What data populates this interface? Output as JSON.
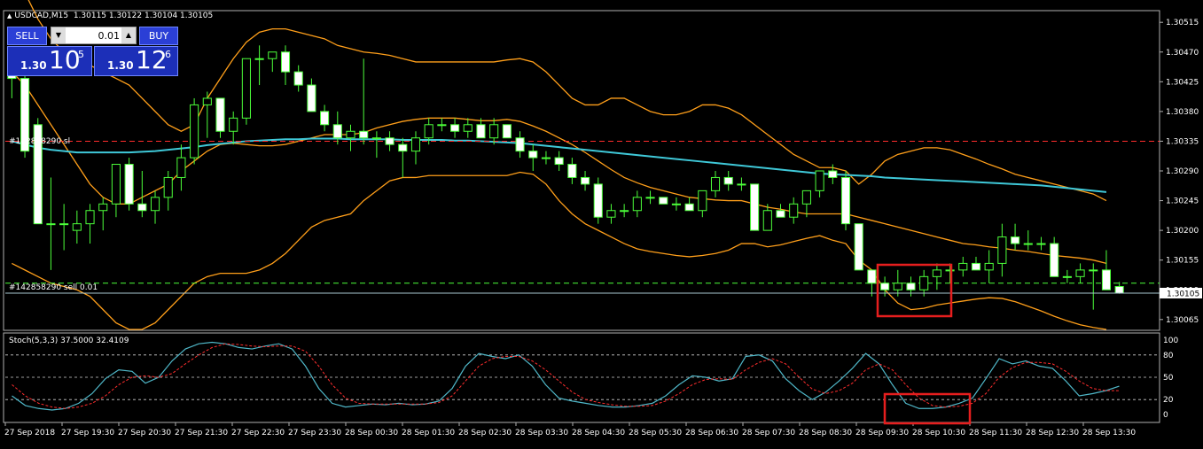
{
  "header": {
    "symbol_tf": "USDCAD,M15",
    "ohlc": "1.30115 1.30122 1.30104 1.30105"
  },
  "trade_panel": {
    "sell_label": "SELL",
    "buy_label": "BUY",
    "lot_value": "0.01",
    "sell_price_prefix": "1.30",
    "sell_price_big": "10",
    "sell_price_sup": "5",
    "buy_price_prefix": "1.30",
    "buy_price_big": "12",
    "buy_price_sup": "6"
  },
  "order_lines": {
    "sl_label": "#142858290 sl",
    "sl_price": 1.30335,
    "entry_label": "#142858290 sell 0.01",
    "entry_price": 1.3012
  },
  "current_price_label": "1.30105",
  "stoch_header": "Stoch(5,3,3) 37.5000 32.4109",
  "colors": {
    "bull": "#ffffff",
    "bear": "#ffffff",
    "wick": "#4cff3a",
    "ma_slow": "#3fc8d8",
    "bollinger": "#ff9f1a",
    "sl_line": "#ff2d2d",
    "entry_line": "#4cff3a",
    "stoch_main": "#4fb7c8",
    "stoch_signal": "#ff2d2d",
    "highlight": "#e61e1e"
  },
  "chart_data": {
    "type": "candlestick",
    "symbol": "USDCAD",
    "timeframe": "M15",
    "ylim": [
      1.3005,
      1.3053
    ],
    "price_ticks": [
      "1.30515",
      "1.30470",
      "1.30425",
      "1.30380",
      "1.30335",
      "1.30290",
      "1.30245",
      "1.30200",
      "1.30155",
      "1.30110",
      "1.30065"
    ],
    "time_labels": [
      "27 Sep 2018",
      "27 Sep 19:30",
      "27 Sep 20:30",
      "27 Sep 21:30",
      "27 Sep 22:30",
      "27 Sep 23:30",
      "28 Sep 00:30",
      "28 Sep 01:30",
      "28 Sep 02:30",
      "28 Sep 03:30",
      "28 Sep 04:30",
      "28 Sep 05:30",
      "28 Sep 06:30",
      "28 Sep 07:30",
      "28 Sep 08:30",
      "28 Sep 09:30",
      "28 Sep 10:30",
      "28 Sep 11:30",
      "28 Sep 12:30",
      "28 Sep 13:30"
    ],
    "candles": [
      [
        1.3044,
        1.3045,
        1.304,
        1.3043
      ],
      [
        1.3043,
        1.3044,
        1.3031,
        1.3032
      ],
      [
        1.3036,
        1.3037,
        1.3021,
        1.3021
      ],
      [
        1.3021,
        1.3028,
        1.3014,
        1.3021
      ],
      [
        1.3021,
        1.3024,
        1.3017,
        1.3021
      ],
      [
        1.302,
        1.3023,
        1.3018,
        1.3021
      ],
      [
        1.3021,
        1.3024,
        1.3018,
        1.3023
      ],
      [
        1.3023,
        1.3025,
        1.302,
        1.3024
      ],
      [
        1.3024,
        1.303,
        1.3022,
        1.303
      ],
      [
        1.303,
        1.3031,
        1.3023,
        1.3024
      ],
      [
        1.3024,
        1.3029,
        1.3022,
        1.3023
      ],
      [
        1.3023,
        1.3026,
        1.3021,
        1.3025
      ],
      [
        1.3025,
        1.3029,
        1.3023,
        1.3028
      ],
      [
        1.3028,
        1.3033,
        1.3026,
        1.3031
      ],
      [
        1.3031,
        1.304,
        1.303,
        1.3039
      ],
      [
        1.3039,
        1.3041,
        1.3034,
        1.304
      ],
      [
        1.304,
        1.304,
        1.3034,
        1.3035
      ],
      [
        1.3035,
        1.3038,
        1.3033,
        1.3037
      ],
      [
        1.3037,
        1.3046,
        1.3036,
        1.3046
      ],
      [
        1.3046,
        1.3048,
        1.3042,
        1.3046
      ],
      [
        1.3046,
        1.3047,
        1.3044,
        1.3047
      ],
      [
        1.3047,
        1.3048,
        1.3042,
        1.3044
      ],
      [
        1.3044,
        1.3045,
        1.3041,
        1.3042
      ],
      [
        1.3042,
        1.3043,
        1.3038,
        1.3038
      ],
      [
        1.3038,
        1.3039,
        1.3035,
        1.3036
      ],
      [
        1.3036,
        1.3038,
        1.3033,
        1.3034
      ],
      [
        1.3034,
        1.3036,
        1.3032,
        1.3035
      ],
      [
        1.3035,
        1.3046,
        1.3033,
        1.3034
      ],
      [
        1.3034,
        1.3035,
        1.3031,
        1.3034
      ],
      [
        1.3034,
        1.3035,
        1.3032,
        1.3033
      ],
      [
        1.3033,
        1.3034,
        1.3028,
        1.3032
      ],
      [
        1.3032,
        1.3035,
        1.303,
        1.3034
      ],
      [
        1.3034,
        1.3037,
        1.3033,
        1.3036
      ],
      [
        1.3036,
        1.3037,
        1.3035,
        1.3036
      ],
      [
        1.3036,
        1.3037,
        1.3034,
        1.3035
      ],
      [
        1.3035,
        1.3037,
        1.3034,
        1.3036
      ],
      [
        1.3036,
        1.3037,
        1.3034,
        1.3034
      ],
      [
        1.3034,
        1.3037,
        1.3033,
        1.3036
      ],
      [
        1.3036,
        1.3036,
        1.3034,
        1.3034
      ],
      [
        1.3034,
        1.3035,
        1.3031,
        1.3032
      ],
      [
        1.3032,
        1.3033,
        1.3029,
        1.3031
      ],
      [
        1.3031,
        1.3032,
        1.303,
        1.3031
      ],
      [
        1.3031,
        1.3032,
        1.3029,
        1.303
      ],
      [
        1.303,
        1.3031,
        1.3027,
        1.3028
      ],
      [
        1.3028,
        1.3029,
        1.3026,
        1.3027
      ],
      [
        1.3027,
        1.3028,
        1.3021,
        1.3022
      ],
      [
        1.3022,
        1.3024,
        1.3021,
        1.3023
      ],
      [
        1.3023,
        1.3024,
        1.3022,
        1.3023
      ],
      [
        1.3023,
        1.3026,
        1.3022,
        1.3025
      ],
      [
        1.3025,
        1.3026,
        1.3024,
        1.3025
      ],
      [
        1.3025,
        1.3025,
        1.3024,
        1.3024
      ],
      [
        1.3024,
        1.3025,
        1.3023,
        1.3024
      ],
      [
        1.3024,
        1.3025,
        1.3023,
        1.3023
      ],
      [
        1.3023,
        1.3026,
        1.3022,
        1.3026
      ],
      [
        1.3026,
        1.3029,
        1.3025,
        1.3028
      ],
      [
        1.3028,
        1.3029,
        1.3026,
        1.3027
      ],
      [
        1.3027,
        1.3028,
        1.3026,
        1.3027
      ],
      [
        1.3027,
        1.3027,
        1.302,
        1.302
      ],
      [
        1.302,
        1.3024,
        1.302,
        1.3023
      ],
      [
        1.3023,
        1.3024,
        1.3022,
        1.3022
      ],
      [
        1.3022,
        1.3025,
        1.3021,
        1.3024
      ],
      [
        1.3024,
        1.3026,
        1.3022,
        1.3026
      ],
      [
        1.3026,
        1.3029,
        1.3025,
        1.3029
      ],
      [
        1.3029,
        1.303,
        1.3027,
        1.3028
      ],
      [
        1.3028,
        1.3029,
        1.302,
        1.3021
      ],
      [
        1.3021,
        1.3021,
        1.3014,
        1.3014
      ],
      [
        1.3014,
        1.3014,
        1.301,
        1.3012
      ],
      [
        1.3012,
        1.3013,
        1.301,
        1.3011
      ],
      [
        1.3011,
        1.3014,
        1.301,
        1.3012
      ],
      [
        1.3012,
        1.3013,
        1.301,
        1.3011
      ],
      [
        1.3011,
        1.3014,
        1.301,
        1.3013
      ],
      [
        1.3013,
        1.3015,
        1.3011,
        1.3014
      ],
      [
        1.3014,
        1.3015,
        1.3012,
        1.3014
      ],
      [
        1.3014,
        1.3016,
        1.3013,
        1.3015
      ],
      [
        1.3015,
        1.3016,
        1.3014,
        1.3014
      ],
      [
        1.3014,
        1.3017,
        1.3012,
        1.3015
      ],
      [
        1.3015,
        1.3021,
        1.3013,
        1.3019
      ],
      [
        1.3019,
        1.3021,
        1.3017,
        1.3018
      ],
      [
        1.3018,
        1.302,
        1.3017,
        1.3018
      ],
      [
        1.3018,
        1.3019,
        1.3017,
        1.3018
      ],
      [
        1.3018,
        1.3019,
        1.3014,
        1.3013
      ],
      [
        1.3013,
        1.3014,
        1.3012,
        1.3013
      ],
      [
        1.3013,
        1.3015,
        1.3012,
        1.3014
      ],
      [
        1.3014,
        1.3015,
        1.3008,
        1.3014
      ],
      [
        1.3014,
        1.3017,
        1.3011,
        1.3011
      ],
      [
        1.30115,
        1.30122,
        1.30104,
        1.30105
      ]
    ],
    "ma": [
      1.30335,
      1.3033,
      1.30325,
      1.30322,
      1.3032,
      1.30318,
      1.30318,
      1.30318,
      1.30318,
      1.30318,
      1.30319,
      1.3032,
      1.30322,
      1.30324,
      1.30326,
      1.30329,
      1.30331,
      1.30333,
      1.30335,
      1.30336,
      1.30337,
      1.30338,
      1.30338,
      1.30339,
      1.30339,
      1.30339,
      1.30338,
      1.30338,
      1.30338,
      1.30338,
      1.30337,
      1.30337,
      1.30337,
      1.30337,
      1.30336,
      1.30336,
      1.30335,
      1.30334,
      1.30333,
      1.30332,
      1.3033,
      1.30328,
      1.30326,
      1.30324,
      1.30322,
      1.3032,
      1.30318,
      1.30316,
      1.30314,
      1.30312,
      1.3031,
      1.30308,
      1.30306,
      1.30304,
      1.30302,
      1.303,
      1.30298,
      1.30296,
      1.30294,
      1.30292,
      1.3029,
      1.30288,
      1.30286,
      1.30285,
      1.30284,
      1.30283,
      1.30282,
      1.3028,
      1.30279,
      1.30278,
      1.30277,
      1.30276,
      1.30275,
      1.30274,
      1.30273,
      1.30272,
      1.30271,
      1.3027,
      1.30269,
      1.30268,
      1.30266,
      1.30264,
      1.30262,
      1.3026,
      1.30258
    ],
    "bb_upper": [
      1.306,
      1.3056,
      1.3052,
      1.3049,
      1.3047,
      1.3046,
      1.3045,
      1.3044,
      1.3043,
      1.3042,
      1.304,
      1.3038,
      1.3036,
      1.3035,
      1.3036,
      1.304,
      1.3043,
      1.3046,
      1.30485,
      1.305,
      1.30505,
      1.30505,
      1.305,
      1.30495,
      1.3049,
      1.3048,
      1.30475,
      1.3047,
      1.30468,
      1.30465,
      1.3046,
      1.30455,
      1.30455,
      1.30455,
      1.30455,
      1.30455,
      1.30455,
      1.30455,
      1.30458,
      1.3046,
      1.30455,
      1.3044,
      1.3042,
      1.304,
      1.3039,
      1.3039,
      1.304,
      1.304,
      1.3039,
      1.3038,
      1.30375,
      1.30375,
      1.3038,
      1.3039,
      1.3039,
      1.30385,
      1.30375,
      1.3036,
      1.30345,
      1.3033,
      1.30315,
      1.30305,
      1.30295,
      1.30295,
      1.3029,
      1.3027,
      1.30285,
      1.30305,
      1.30315,
      1.3032,
      1.30325,
      1.30325,
      1.30322,
      1.30315,
      1.30308,
      1.303,
      1.30293,
      1.30285,
      1.3028,
      1.30275,
      1.3027,
      1.30265,
      1.3026,
      1.30255,
      1.30245
    ],
    "bb_mid": [
      1.3044,
      1.3042,
      1.3039,
      1.3036,
      1.3033,
      1.303,
      1.3027,
      1.3025,
      1.3024,
      1.3024,
      1.3025,
      1.3026,
      1.3027,
      1.3029,
      1.30305,
      1.3032,
      1.3033,
      1.30332,
      1.3033,
      1.30328,
      1.30328,
      1.3033,
      1.30335,
      1.3034,
      1.30345,
      1.30345,
      1.30345,
      1.30348,
      1.30355,
      1.3036,
      1.30365,
      1.30368,
      1.3037,
      1.3037,
      1.3037,
      1.30368,
      1.30366,
      1.30366,
      1.30368,
      1.30365,
      1.30358,
      1.3035,
      1.3034,
      1.3033,
      1.30318,
      1.30305,
      1.30292,
      1.3028,
      1.30272,
      1.30265,
      1.3026,
      1.30255,
      1.3025,
      1.30248,
      1.30246,
      1.30245,
      1.30245,
      1.3024,
      1.30235,
      1.30232,
      1.30228,
      1.30225,
      1.30225,
      1.30225,
      1.30225,
      1.3022,
      1.30215,
      1.3021,
      1.30205,
      1.302,
      1.30195,
      1.3019,
      1.30185,
      1.3018,
      1.30178,
      1.30175,
      1.30173,
      1.3017,
      1.30168,
      1.30165,
      1.30162,
      1.3016,
      1.30158,
      1.30155,
      1.3015
    ],
    "bb_lower": [
      1.3015,
      1.3014,
      1.3013,
      1.3012,
      1.30115,
      1.3011,
      1.301,
      1.3008,
      1.3006,
      1.3005,
      1.3005,
      1.3006,
      1.3008,
      1.301,
      1.3012,
      1.3013,
      1.30135,
      1.30135,
      1.30135,
      1.3014,
      1.3015,
      1.30165,
      1.30185,
      1.30205,
      1.30215,
      1.3022,
      1.30225,
      1.30245,
      1.3026,
      1.30275,
      1.3028,
      1.3028,
      1.30283,
      1.30283,
      1.30283,
      1.30283,
      1.30283,
      1.30283,
      1.30283,
      1.30288,
      1.30285,
      1.3027,
      1.30245,
      1.30225,
      1.3021,
      1.302,
      1.3019,
      1.3018,
      1.30172,
      1.30168,
      1.30165,
      1.30162,
      1.3016,
      1.30162,
      1.30165,
      1.3017,
      1.3018,
      1.3018,
      1.30175,
      1.30178,
      1.30183,
      1.30188,
      1.30192,
      1.30185,
      1.3018,
      1.30155,
      1.3014,
      1.3011,
      1.3009,
      1.3008,
      1.30082,
      1.30087,
      1.3009,
      1.30093,
      1.30096,
      1.30098,
      1.30097,
      1.30092,
      1.30085,
      1.30078,
      1.3007,
      1.30063,
      1.30057,
      1.30053,
      1.3005
    ],
    "sub_panels": [
      {
        "name": "Stoch(5,3,3)",
        "ylim": [
          0,
          100
        ],
        "levels": [
          20,
          50,
          80
        ],
        "ticks": [
          "100",
          "80",
          "50",
          "20",
          "0"
        ],
        "main": [
          25,
          12,
          8,
          6,
          8,
          15,
          28,
          48,
          60,
          58,
          42,
          50,
          72,
          88,
          95,
          97,
          95,
          90,
          88,
          92,
          95,
          88,
          65,
          35,
          15,
          10,
          12,
          14,
          13,
          15,
          13,
          14,
          18,
          35,
          65,
          82,
          78,
          75,
          80,
          65,
          40,
          22,
          18,
          15,
          12,
          10,
          10,
          12,
          15,
          25,
          40,
          52,
          50,
          45,
          48,
          78,
          80,
          72,
          48,
          32,
          20,
          30,
          45,
          62,
          82,
          68,
          40,
          15,
          8,
          8,
          10,
          15,
          22,
          48,
          75,
          68,
          72,
          65,
          62,
          45,
          25,
          28,
          32,
          38
        ],
        "signal": [
          40,
          25,
          15,
          10,
          8,
          10,
          15,
          25,
          40,
          50,
          52,
          50,
          55,
          68,
          80,
          90,
          95,
          94,
          92,
          91,
          92,
          92,
          85,
          65,
          40,
          22,
          15,
          14,
          14,
          14,
          14,
          14,
          16,
          25,
          45,
          65,
          75,
          78,
          78,
          72,
          60,
          45,
          30,
          20,
          16,
          13,
          11,
          11,
          12,
          18,
          28,
          40,
          47,
          48,
          47,
          60,
          70,
          75,
          68,
          50,
          34,
          28,
          32,
          42,
          60,
          68,
          60,
          40,
          22,
          12,
          10,
          11,
          15,
          28,
          50,
          63,
          70,
          70,
          68,
          58,
          45,
          35,
          32,
          32
        ]
      }
    ]
  },
  "annotations": [
    "highlight-box-price",
    "highlight-box-stoch"
  ]
}
